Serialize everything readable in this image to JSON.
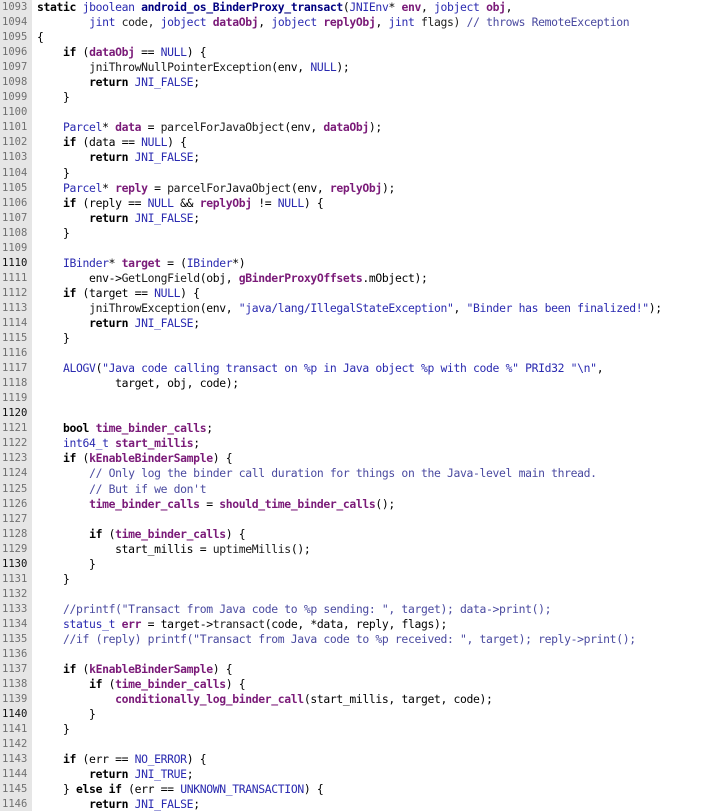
{
  "editor": {
    "background": "#ffffff",
    "gutter_background": "#e6e6e6",
    "lines": [
      {
        "n": "1093",
        "t": [
          [
            "static",
            "k"
          ],
          [
            " ",
            ""
          ],
          [
            "jboolean",
            "t"
          ],
          [
            " ",
            ""
          ],
          [
            "android_os_BinderProxy_transact",
            "fd"
          ],
          [
            "(",
            "p"
          ],
          [
            "JNIEnv",
            "t"
          ],
          [
            "* ",
            "p"
          ],
          [
            "env",
            "v"
          ],
          [
            ", ",
            "p"
          ],
          [
            "jobject",
            "t"
          ],
          [
            " ",
            ""
          ],
          [
            "obj",
            "v"
          ],
          [
            ",",
            "p"
          ]
        ]
      },
      {
        "n": "1094",
        "t": [
          [
            "        ",
            ""
          ],
          [
            "jint",
            "t"
          ],
          [
            " code, ",
            ""
          ],
          [
            "jobject",
            "t"
          ],
          [
            " ",
            ""
          ],
          [
            "dataObj",
            "v"
          ],
          [
            ", ",
            "p"
          ],
          [
            "jobject",
            "t"
          ],
          [
            " ",
            ""
          ],
          [
            "replyObj",
            "v"
          ],
          [
            ", ",
            "p"
          ],
          [
            "jint",
            "t"
          ],
          [
            " flags) ",
            ""
          ],
          [
            "// throws RemoteException",
            "c"
          ]
        ]
      },
      {
        "n": "1095",
        "t": [
          [
            "{",
            "p"
          ]
        ]
      },
      {
        "n": "1096",
        "t": [
          [
            "    ",
            ""
          ],
          [
            "if",
            "k"
          ],
          [
            " (",
            "p"
          ],
          [
            "dataObj",
            "v"
          ],
          [
            " == ",
            "p"
          ],
          [
            "NULL",
            "m"
          ],
          [
            ") {",
            "p"
          ]
        ]
      },
      {
        "n": "1097",
        "t": [
          [
            "        ",
            ""
          ],
          [
            "jniThrowNullPointerException",
            "f"
          ],
          [
            "(env, ",
            "p"
          ],
          [
            "NULL",
            "m"
          ],
          [
            ");",
            "p"
          ]
        ]
      },
      {
        "n": "1098",
        "t": [
          [
            "        ",
            ""
          ],
          [
            "return",
            "k"
          ],
          [
            " ",
            ""
          ],
          [
            "JNI_FALSE",
            "m"
          ],
          [
            ";",
            "p"
          ]
        ]
      },
      {
        "n": "1099",
        "t": [
          [
            "    }",
            "p"
          ]
        ]
      },
      {
        "n": "1100",
        "t": []
      },
      {
        "n": "1101",
        "t": [
          [
            "    ",
            ""
          ],
          [
            "Parcel",
            "t"
          ],
          [
            "* ",
            "p"
          ],
          [
            "data",
            "v"
          ],
          [
            " = ",
            "p"
          ],
          [
            "parcelForJavaObject",
            "f"
          ],
          [
            "(env, ",
            "p"
          ],
          [
            "dataObj",
            "v"
          ],
          [
            ");",
            "p"
          ]
        ]
      },
      {
        "n": "1102",
        "t": [
          [
            "    ",
            ""
          ],
          [
            "if",
            "k"
          ],
          [
            " (data == ",
            "p"
          ],
          [
            "NULL",
            "m"
          ],
          [
            ") {",
            "p"
          ]
        ]
      },
      {
        "n": "1103",
        "t": [
          [
            "        ",
            ""
          ],
          [
            "return",
            "k"
          ],
          [
            " ",
            ""
          ],
          [
            "JNI_FALSE",
            "m"
          ],
          [
            ";",
            "p"
          ]
        ]
      },
      {
        "n": "1104",
        "t": [
          [
            "    }",
            "p"
          ]
        ]
      },
      {
        "n": "1105",
        "t": [
          [
            "    ",
            ""
          ],
          [
            "Parcel",
            "t"
          ],
          [
            "* ",
            "p"
          ],
          [
            "reply",
            "v"
          ],
          [
            " = ",
            "p"
          ],
          [
            "parcelForJavaObject",
            "f"
          ],
          [
            "(env, ",
            "p"
          ],
          [
            "replyObj",
            "v"
          ],
          [
            ");",
            "p"
          ]
        ]
      },
      {
        "n": "1106",
        "t": [
          [
            "    ",
            ""
          ],
          [
            "if",
            "k"
          ],
          [
            " (reply == ",
            "p"
          ],
          [
            "NULL",
            "m"
          ],
          [
            " && ",
            "p"
          ],
          [
            "replyObj",
            "v"
          ],
          [
            " != ",
            "p"
          ],
          [
            "NULL",
            "m"
          ],
          [
            ") {",
            "p"
          ]
        ]
      },
      {
        "n": "1107",
        "t": [
          [
            "        ",
            ""
          ],
          [
            "return",
            "k"
          ],
          [
            " ",
            ""
          ],
          [
            "JNI_FALSE",
            "m"
          ],
          [
            ";",
            "p"
          ]
        ]
      },
      {
        "n": "1108",
        "t": [
          [
            "    }",
            "p"
          ]
        ]
      },
      {
        "n": "1109",
        "t": []
      },
      {
        "n": "1110",
        "mark": true,
        "t": [
          [
            "    ",
            ""
          ],
          [
            "IBinder",
            "t"
          ],
          [
            "* ",
            "p"
          ],
          [
            "target",
            "v"
          ],
          [
            " = (",
            "p"
          ],
          [
            "IBinder",
            "t"
          ],
          [
            "*)",
            "p"
          ]
        ]
      },
      {
        "n": "1111",
        "t": [
          [
            "        env->",
            "p"
          ],
          [
            "GetLongField",
            "f"
          ],
          [
            "(obj, ",
            "p"
          ],
          [
            "gBinderProxyOffsets",
            "v"
          ],
          [
            ".mObject);",
            "p"
          ]
        ]
      },
      {
        "n": "1112",
        "t": [
          [
            "    ",
            ""
          ],
          [
            "if",
            "k"
          ],
          [
            " (target == ",
            "p"
          ],
          [
            "NULL",
            "m"
          ],
          [
            ") {",
            "p"
          ]
        ]
      },
      {
        "n": "1113",
        "t": [
          [
            "        ",
            ""
          ],
          [
            "jniThrowException",
            "f"
          ],
          [
            "(env, ",
            "p"
          ],
          [
            "\"java/lang/IllegalStateException\"",
            "s"
          ],
          [
            ", ",
            "p"
          ],
          [
            "\"Binder has been finalized!\"",
            "s"
          ],
          [
            ");",
            "p"
          ]
        ]
      },
      {
        "n": "1114",
        "t": [
          [
            "        ",
            ""
          ],
          [
            "return",
            "k"
          ],
          [
            " ",
            ""
          ],
          [
            "JNI_FALSE",
            "m"
          ],
          [
            ";",
            "p"
          ]
        ]
      },
      {
        "n": "1115",
        "t": [
          [
            "    }",
            "p"
          ]
        ]
      },
      {
        "n": "1116",
        "t": []
      },
      {
        "n": "1117",
        "t": [
          [
            "    ",
            ""
          ],
          [
            "ALOGV",
            "m"
          ],
          [
            "(",
            "p"
          ],
          [
            "\"Java code calling transact on %p in Java object %p with code %\"",
            "s"
          ],
          [
            " PRId32 ",
            "m"
          ],
          [
            "\"\\n\"",
            "s"
          ],
          [
            ",",
            "p"
          ]
        ]
      },
      {
        "n": "1118",
        "t": [
          [
            "            target, obj, code);",
            "p"
          ]
        ]
      },
      {
        "n": "1119",
        "t": []
      },
      {
        "n": "1120",
        "mark": true,
        "t": []
      },
      {
        "n": "1121",
        "t": [
          [
            "    ",
            ""
          ],
          [
            "bool",
            "k"
          ],
          [
            " ",
            ""
          ],
          [
            "time_binder_calls",
            "v"
          ],
          [
            ";",
            "p"
          ]
        ]
      },
      {
        "n": "1122",
        "t": [
          [
            "    ",
            ""
          ],
          [
            "int64_t",
            "t"
          ],
          [
            " ",
            ""
          ],
          [
            "start_millis",
            "v"
          ],
          [
            ";",
            "p"
          ]
        ]
      },
      {
        "n": "1123",
        "t": [
          [
            "    ",
            ""
          ],
          [
            "if",
            "k"
          ],
          [
            " (",
            "p"
          ],
          [
            "kEnableBinderSample",
            "v"
          ],
          [
            ") {",
            "p"
          ]
        ]
      },
      {
        "n": "1124",
        "t": [
          [
            "        ",
            ""
          ],
          [
            "// Only log the binder call duration for things on the Java-level main thread.",
            "c"
          ]
        ]
      },
      {
        "n": "1125",
        "t": [
          [
            "        ",
            ""
          ],
          [
            "// But if we don't",
            "c"
          ]
        ]
      },
      {
        "n": "1126",
        "t": [
          [
            "        ",
            ""
          ],
          [
            "time_binder_calls",
            "v"
          ],
          [
            " = ",
            "p"
          ],
          [
            "should_time_binder_calls",
            "v"
          ],
          [
            "();",
            "p"
          ]
        ]
      },
      {
        "n": "1127",
        "t": []
      },
      {
        "n": "1128",
        "t": [
          [
            "        ",
            ""
          ],
          [
            "if",
            "k"
          ],
          [
            " (",
            "p"
          ],
          [
            "time_binder_calls",
            "v"
          ],
          [
            ") {",
            "p"
          ]
        ]
      },
      {
        "n": "1129",
        "t": [
          [
            "            start_millis = ",
            "p"
          ],
          [
            "uptimeMillis",
            "f"
          ],
          [
            "();",
            "p"
          ]
        ]
      },
      {
        "n": "1130",
        "mark": true,
        "t": [
          [
            "        }",
            "p"
          ]
        ]
      },
      {
        "n": "1131",
        "t": [
          [
            "    }",
            "p"
          ]
        ]
      },
      {
        "n": "1132",
        "t": []
      },
      {
        "n": "1133",
        "t": [
          [
            "    ",
            ""
          ],
          [
            "//printf(\"Transact from Java code to %p sending: \", target); data->print();",
            "c"
          ]
        ]
      },
      {
        "n": "1134",
        "t": [
          [
            "    ",
            ""
          ],
          [
            "status_t",
            "t"
          ],
          [
            " ",
            ""
          ],
          [
            "err",
            "v"
          ],
          [
            " = target->",
            "p"
          ],
          [
            "transact",
            "f"
          ],
          [
            "(code, *data, reply, flags);",
            "p"
          ]
        ]
      },
      {
        "n": "1135",
        "t": [
          [
            "    ",
            ""
          ],
          [
            "//if (reply) printf(\"Transact from Java code to %p received: \", target); reply->print();",
            "c"
          ]
        ]
      },
      {
        "n": "1136",
        "t": []
      },
      {
        "n": "1137",
        "t": [
          [
            "    ",
            ""
          ],
          [
            "if",
            "k"
          ],
          [
            " (",
            "p"
          ],
          [
            "kEnableBinderSample",
            "v"
          ],
          [
            ") {",
            "p"
          ]
        ]
      },
      {
        "n": "1138",
        "t": [
          [
            "        ",
            ""
          ],
          [
            "if",
            "k"
          ],
          [
            " (",
            "p"
          ],
          [
            "time_binder_calls",
            "v"
          ],
          [
            ") {",
            "p"
          ]
        ]
      },
      {
        "n": "1139",
        "t": [
          [
            "            ",
            ""
          ],
          [
            "conditionally_log_binder_call",
            "v"
          ],
          [
            "(start_millis, target, code);",
            "p"
          ]
        ]
      },
      {
        "n": "1140",
        "mark": true,
        "t": [
          [
            "        }",
            "p"
          ]
        ]
      },
      {
        "n": "1141",
        "t": [
          [
            "    }",
            "p"
          ]
        ]
      },
      {
        "n": "1142",
        "t": []
      },
      {
        "n": "1143",
        "t": [
          [
            "    ",
            ""
          ],
          [
            "if",
            "k"
          ],
          [
            " (err == ",
            "p"
          ],
          [
            "NO_ERROR",
            "m"
          ],
          [
            ") {",
            "p"
          ]
        ]
      },
      {
        "n": "1144",
        "t": [
          [
            "        ",
            ""
          ],
          [
            "return",
            "k"
          ],
          [
            " ",
            ""
          ],
          [
            "JNI_TRUE",
            "m"
          ],
          [
            ";",
            "p"
          ]
        ]
      },
      {
        "n": "1145",
        "t": [
          [
            "    } ",
            "p"
          ],
          [
            "else",
            "k"
          ],
          [
            " ",
            ""
          ],
          [
            "if",
            "k"
          ],
          [
            " (err == ",
            "p"
          ],
          [
            "UNKNOWN_TRANSACTION",
            "m"
          ],
          [
            ") {",
            "p"
          ]
        ]
      },
      {
        "n": "1146",
        "t": [
          [
            "        ",
            ""
          ],
          [
            "return",
            "k"
          ],
          [
            " ",
            ""
          ],
          [
            "JNI_FALSE",
            "m"
          ],
          [
            ";",
            "p"
          ]
        ]
      }
    ]
  }
}
